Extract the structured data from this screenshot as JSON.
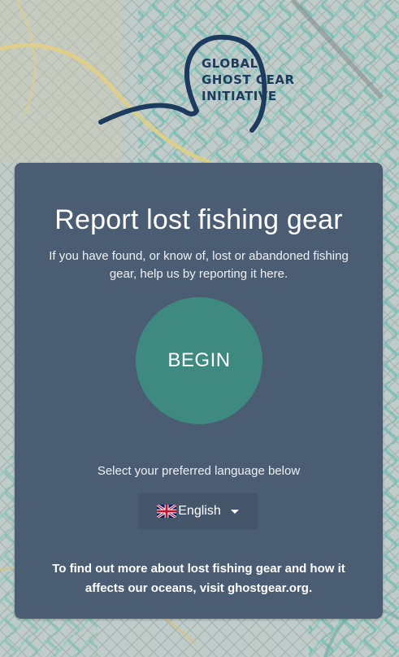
{
  "logo": {
    "line1": "GLOBAL",
    "line2": "GHOST GEAR",
    "line3": "INITIATIVE",
    "icon": "wave-arc-logo-icon"
  },
  "card": {
    "title": "Report lost fishing gear",
    "intro": "If you have found, or know of, lost or abandoned fishing gear, help us by reporting it here.",
    "begin_label": "BEGIN",
    "language_prompt": "Select your preferred language below",
    "language": {
      "selected": "English",
      "flag_icon": "uk-flag-icon",
      "dropdown_icon": "caret-down-icon"
    },
    "footer": "To find out more about lost fishing gear and how it affects our oceans, visit ghostgear.org."
  },
  "colors": {
    "card_bg": "#4a5d73",
    "button_bg": "#3e8a80",
    "logo_navy": "#1c3b5e"
  }
}
